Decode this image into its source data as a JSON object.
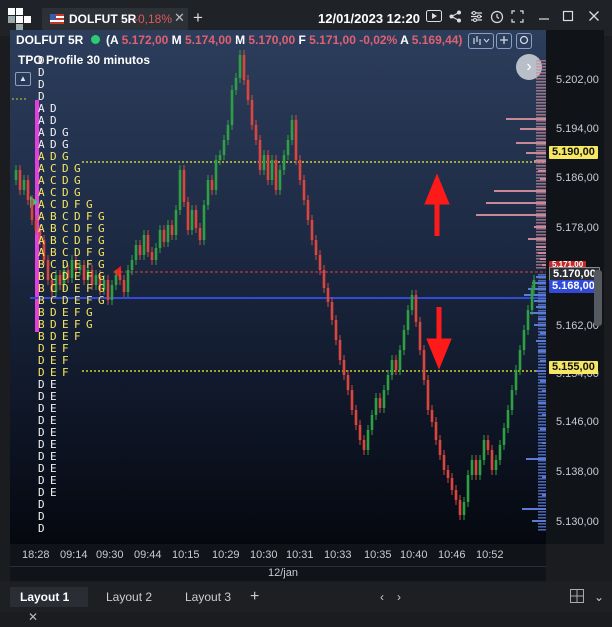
{
  "app": {
    "tab_title": "DOLFUT 5R",
    "tab_change": "-0,18%",
    "tab_close": "✕",
    "tab_add": "+",
    "datetime": "12/01/2023 12:20"
  },
  "toolbar_icons": [
    "play-icon",
    "share-icon",
    "settings-icon",
    "history-icon",
    "fit-icon",
    "minimize-icon",
    "maximize-icon",
    "close-icon"
  ],
  "instrument_bar": {
    "symbol": "DOLFUT 5R",
    "open_label": "(A",
    "open_value": "5.172,00",
    "max_label": "M",
    "max_value": "5.174,00",
    "min_label": "M",
    "min_value": "5.170,00",
    "close_label": "F",
    "close_value": "5.171,00",
    "variation": "-0,02%",
    "avg_label": "A",
    "avg_value": "5.169,44)"
  },
  "tpo_title": "TPO Profile 30 minutos",
  "colors": {
    "up_candle": "#2ea043",
    "down_candle": "#d9463e",
    "tpo_white": "#f2f2f2",
    "tpo_yellow": "#f5e663",
    "poc_magenta": "#e040e0",
    "dotted_yellow": "#cfcf2e",
    "dotted_red": "#d94040",
    "blue_line": "#2f4bd8",
    "arrow_red": "#ff1a1a",
    "profile_red": "#c98a98",
    "profile_blue": "#5b7bd5"
  },
  "tpo_rows": [
    {
      "letters": "D",
      "tone": "w"
    },
    {
      "letters": "D",
      "tone": "w"
    },
    {
      "letters": "D",
      "tone": "w"
    },
    {
      "letters": "D",
      "tone": "w"
    },
    {
      "letters": "AD",
      "tone": "w"
    },
    {
      "letters": "AD",
      "tone": "w"
    },
    {
      "letters": "ADG",
      "tone": "w"
    },
    {
      "letters": "ADG",
      "tone": "w"
    },
    {
      "letters": "ADG",
      "tone": "y"
    },
    {
      "letters": "ACDG",
      "tone": "y"
    },
    {
      "letters": "ACDG",
      "tone": "y"
    },
    {
      "letters": "ACDG",
      "tone": "y"
    },
    {
      "letters": "ACDFG",
      "tone": "y"
    },
    {
      "letters": "ABCDFG",
      "tone": "y"
    },
    {
      "letters": "ABCDFG",
      "tone": "y"
    },
    {
      "letters": "ABCDFG",
      "tone": "y"
    },
    {
      "letters": "ABCDFG",
      "tone": "y"
    },
    {
      "letters": "BCDEFG",
      "tone": "y"
    },
    {
      "letters": "BCDEFG",
      "tone": "y"
    },
    {
      "letters": "BCDEFG",
      "tone": "y"
    },
    {
      "letters": "BCDEFG",
      "tone": "y"
    },
    {
      "letters": "BDEFG",
      "tone": "y"
    },
    {
      "letters": "BDEFG",
      "tone": "y"
    },
    {
      "letters": "BDEF",
      "tone": "y"
    },
    {
      "letters": "DEF",
      "tone": "y"
    },
    {
      "letters": "DEF",
      "tone": "y"
    },
    {
      "letters": "DEF",
      "tone": "y"
    },
    {
      "letters": "DE",
      "tone": "w"
    },
    {
      "letters": "DE",
      "tone": "w"
    },
    {
      "letters": "DE",
      "tone": "w"
    },
    {
      "letters": "DE",
      "tone": "w"
    },
    {
      "letters": "DE",
      "tone": "w"
    },
    {
      "letters": "DE",
      "tone": "w"
    },
    {
      "letters": "DE",
      "tone": "w"
    },
    {
      "letters": "DE",
      "tone": "w"
    },
    {
      "letters": "DE",
      "tone": "w"
    },
    {
      "letters": "DE",
      "tone": "w"
    },
    {
      "letters": "D",
      "tone": "w"
    },
    {
      "letters": "D",
      "tone": "w"
    },
    {
      "letters": "D",
      "tone": "w"
    }
  ],
  "price_axis": {
    "ticks": [
      "5.202,00",
      "5.194,00",
      "5.186,00",
      "5.178,00",
      "5.170,00",
      "5.162,00",
      "5.154,00",
      "5.146,00",
      "5.138,00",
      "5.130,00"
    ],
    "tag_upper": "5.190,00",
    "tag_lower": "5.155,00",
    "tag_last_hidden": "5.171,00",
    "tag_last": "5.170,00",
    "tag_blue": "5.168,00"
  },
  "time_axis": [
    "18:28",
    "09:14",
    "09:30",
    "09:44",
    "10:15",
    "10:29",
    "10:30",
    "10:31",
    "10:33",
    "10:35",
    "10:40",
    "10:46",
    "10:52"
  ],
  "date_label": "12/jan",
  "bottom_tabs": [
    {
      "label": "Layout 1",
      "active": true
    },
    {
      "label": "Layout 2",
      "active": false
    },
    {
      "label": "Layout 3",
      "active": false
    }
  ],
  "bottom_close": "✕",
  "bottom_add": "+"
}
